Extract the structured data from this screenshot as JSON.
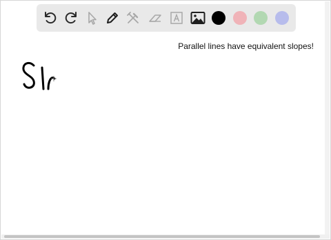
{
  "toolbar": {
    "tools": [
      {
        "icon": "undo-icon"
      },
      {
        "icon": "redo-icon"
      },
      {
        "icon": "select-pointer-icon"
      },
      {
        "icon": "pen-icon"
      },
      {
        "icon": "tools-icon"
      },
      {
        "icon": "eraser-icon"
      },
      {
        "icon": "text-box-icon"
      },
      {
        "icon": "image-icon"
      }
    ],
    "colors": [
      {
        "name": "black",
        "hex": "#000000",
        "selected": true
      },
      {
        "name": "pink",
        "hex": "#f0b3b8",
        "selected": false
      },
      {
        "name": "green",
        "hex": "#b2d8b2",
        "selected": false
      },
      {
        "name": "blue",
        "hex": "#b7bcec",
        "selected": false
      }
    ]
  },
  "canvas": {
    "note": "Parallel lines have equivalent slopes!",
    "ink_color": "#000000"
  }
}
